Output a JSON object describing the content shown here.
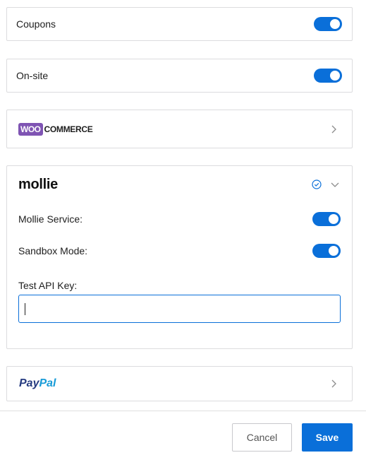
{
  "coupons": {
    "label": "Coupons",
    "enabled": true
  },
  "onsite": {
    "label": "On-site",
    "enabled": true
  },
  "woocommerce": {
    "logo_badge": "WOO",
    "logo_text": "COMMERCE"
  },
  "mollie": {
    "logo_text": "mollie",
    "service_label": "Mollie Service:",
    "service_enabled": true,
    "sandbox_label": "Sandbox Mode:",
    "sandbox_enabled": true,
    "api_key_label": "Test API Key:",
    "api_key_value": ""
  },
  "paypal": {
    "logo_pay": "Pay",
    "logo_pal": "Pal"
  },
  "footer": {
    "cancel_label": "Cancel",
    "save_label": "Save"
  },
  "colors": {
    "accent": "#0a6fd9",
    "woo_purple": "#7f54b3",
    "paypal_dark": "#253b80",
    "paypal_light": "#179bd7"
  }
}
